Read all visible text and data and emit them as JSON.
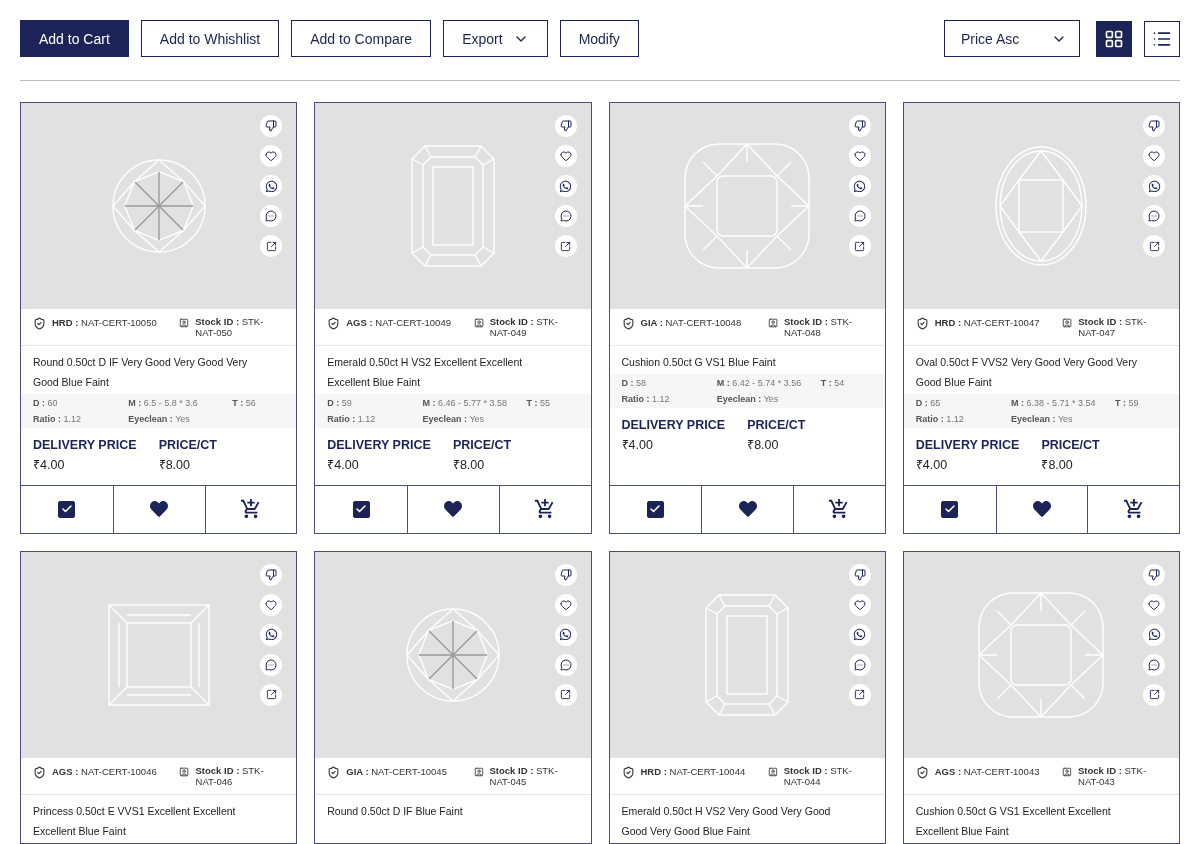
{
  "toolbar": {
    "buttons": [
      {
        "label": "Add to Cart",
        "primary": true
      },
      {
        "label": "Add to Whishlist",
        "primary": false
      },
      {
        "label": "Add to Compare",
        "primary": false
      },
      {
        "label": "Export",
        "primary": false,
        "dropdown": true
      },
      {
        "label": "Modify",
        "primary": false
      }
    ],
    "sort": {
      "value": "Price Asc"
    },
    "views": [
      {
        "kind": "grid",
        "selected": true
      },
      {
        "kind": "list",
        "selected": false
      }
    ]
  },
  "cards": [
    {
      "kind": "round",
      "lab": "HRD :",
      "cert": "NAT-CERT-10050",
      "stock_label": "Stock ID :",
      "stock": "STK- NAT-050",
      "title": "Round 0.50ct D IF Very Good Very Good Very Good Blue Faint",
      "specs": [
        {
          "label": "D :",
          "value": "60"
        },
        {
          "label": "M :",
          "value": "6.5 - 5.8 * 3.6"
        },
        {
          "label": "T :",
          "value": "56"
        },
        {
          "label": "Ratio :",
          "value": "1.12"
        },
        {
          "label": "Eyeclean :",
          "value": "Yes"
        }
      ],
      "prices": [
        {
          "label": "DELIVERY PRICE",
          "value": "₹4.00"
        },
        {
          "label": "PRICE/CT",
          "value": "₹8.00"
        }
      ],
      "checked": true
    },
    {
      "kind": "emerald",
      "lab": "AGS :",
      "cert": "NAT-CERT-10049",
      "stock_label": "Stock ID :",
      "stock": "STK-NAT-049",
      "title": "Emerald 0.50ct H VS2 Excellent Excellent Excellent Blue Faint",
      "specs": [
        {
          "label": "D :",
          "value": "59"
        },
        {
          "label": "M :",
          "value": "6.46 - 5.77 * 3.58"
        },
        {
          "label": "T :",
          "value": "55"
        },
        {
          "label": "Ratio :",
          "value": "1.12"
        },
        {
          "label": "Eyeclean :",
          "value": "Yes"
        }
      ],
      "prices": [
        {
          "label": "DELIVERY PRICE",
          "value": "₹4.00"
        },
        {
          "label": "PRICE/CT",
          "value": "₹8.00"
        }
      ],
      "checked": true
    },
    {
      "kind": "cushion",
      "lab": "GIA :",
      "cert": "NAT-CERT-10048",
      "stock_label": "Stock ID :",
      "stock": "STK-NAT-048",
      "title": "Cushion 0.50ct G VS1 Blue Faint",
      "specs": [
        {
          "label": "D :",
          "value": "58"
        },
        {
          "label": "M :",
          "value": "6.42 - 5.74 * 3.56"
        },
        {
          "label": "T :",
          "value": "54"
        },
        {
          "label": "Ratio :",
          "value": "1.12"
        },
        {
          "label": "Eyeclean :",
          "value": "Yes"
        }
      ],
      "prices": [
        {
          "label": "DELIVERY PRICE",
          "value": "₹4.00"
        },
        {
          "label": "PRICE/CT",
          "value": "₹8.00"
        }
      ],
      "checked": true
    },
    {
      "kind": "oval",
      "lab": "HRD :",
      "cert": "NAT-CERT-10047",
      "stock_label": "Stock ID :",
      "stock": "STK-NAT-047",
      "title": "Oval 0.50ct F VVS2 Very Good Very Good Very Good Blue Faint",
      "specs": [
        {
          "label": "D :",
          "value": "65"
        },
        {
          "label": "M :",
          "value": "6.38 - 5.71 * 3.54"
        },
        {
          "label": "T :",
          "value": "59"
        },
        {
          "label": "Ratio :",
          "value": "1.12"
        },
        {
          "label": "Eyeclean :",
          "value": "Yes"
        }
      ],
      "prices": [
        {
          "label": "DELIVERY PRICE",
          "value": "₹4.00"
        },
        {
          "label": "PRICE/CT",
          "value": "₹8.00"
        }
      ],
      "checked": true
    },
    {
      "kind": "princess",
      "lab": "AGS :",
      "cert": "NAT-CERT-10046",
      "stock_label": "Stock ID :",
      "stock": "STK-NAT-046",
      "title": "Princess 0.50ct E VVS1 Excellent Excellent Excellent Blue Faint"
    },
    {
      "kind": "round",
      "lab": "GIA :",
      "cert": "NAT-CERT-10045",
      "stock_label": "Stock ID :",
      "stock": "STK- NAT-045",
      "title": "Round 0.50ct D IF Blue Faint"
    },
    {
      "kind": "emerald",
      "lab": "HRD :",
      "cert": "NAT-CERT-10044",
      "stock_label": "Stock ID :",
      "stock": "STK- NAT-044",
      "title": "Emerald 0.50ct H VS2 Very Good Very Good Good Very Good Blue Faint"
    },
    {
      "kind": "cushion",
      "lab": "AGS :",
      "cert": "NAT-CERT-10043",
      "stock_label": "Stock ID :",
      "stock": "STK- NAT-043",
      "title": "Cushion 0.50ct G VS1 Excellent Excellent Excellent Blue Faint"
    }
  ]
}
